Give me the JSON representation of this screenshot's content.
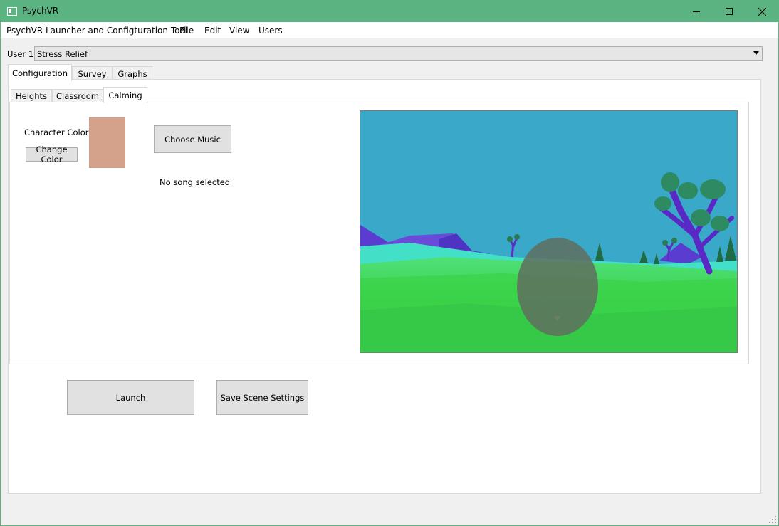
{
  "window": {
    "title": "PsychVR",
    "titlebar_color": "#5bb381"
  },
  "menu": {
    "app_label": "PsychVR Launcher and Configturation Tool",
    "items": [
      "File",
      "Edit",
      "View",
      "Users"
    ]
  },
  "user": {
    "label": "User 1",
    "selected_scenario": "Stress Relief"
  },
  "tabs": [
    "Configuration",
    "Survey",
    "Graphs"
  ],
  "subtabs": [
    "Heights",
    "Classroom",
    "Calming"
  ],
  "calming": {
    "character_color_label": "Character Color",
    "change_color_button": "Change Color",
    "swatch_color": "#d4a28a",
    "choose_music_button": "Choose Music",
    "song_status": "No song selected"
  },
  "actions": {
    "launch_button": "Launch",
    "save_button": "Save Scene Settings"
  },
  "icons": [
    "app-window-icon",
    "minimize-icon",
    "maximize-icon",
    "close-icon",
    "chevron-down-icon",
    "resize-grip-icon"
  ]
}
